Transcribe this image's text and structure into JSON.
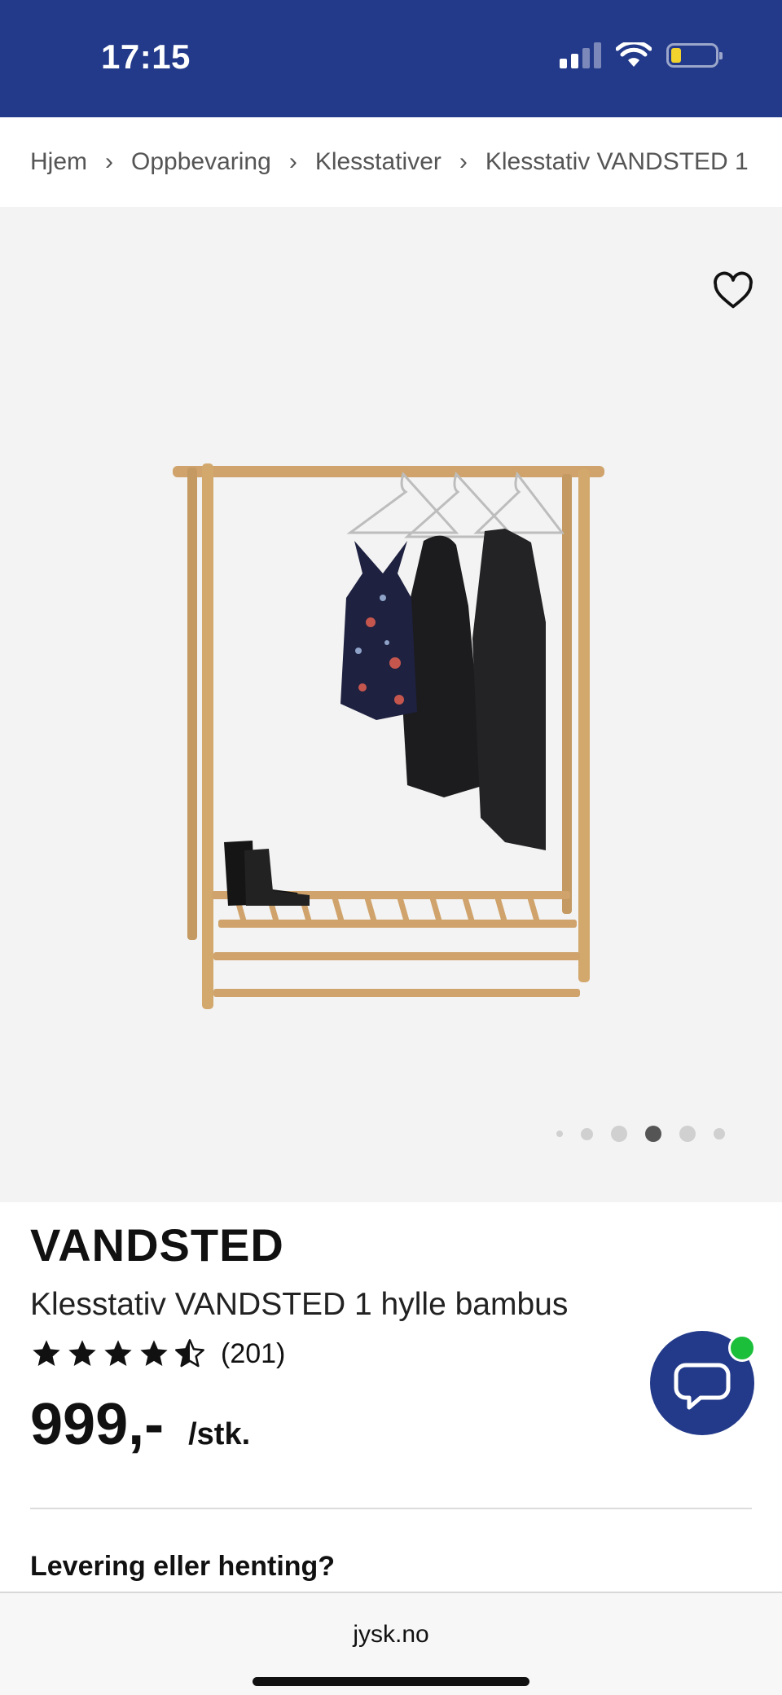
{
  "status_bar": {
    "time": "17:15"
  },
  "breadcrumb": {
    "items": [
      "Hjem",
      "Oppbevaring",
      "Klesstativer",
      "Klesstativ VANDSTED 1"
    ],
    "separator": "›"
  },
  "gallery": {
    "image_count": 6,
    "active_index": 3
  },
  "product": {
    "brand": "VANDSTED",
    "name": "Klesstativ VANDSTED 1 hylle bambus",
    "rating": 4.5,
    "rating_count": "(201)",
    "price": "999,-",
    "unit": "/stk."
  },
  "delivery": {
    "title": "Levering eller henting?"
  },
  "browser": {
    "url": "jysk.no"
  },
  "colors": {
    "brand_blue": "#233a8a",
    "online_green": "#1bbf3a",
    "battery_yellow": "#f2d22c"
  },
  "icons": {
    "favorite": "heart-outline-icon",
    "chat": "speech-bubble-icon",
    "signal": "cellular-signal-icon",
    "wifi": "wifi-icon",
    "battery": "battery-icon"
  }
}
